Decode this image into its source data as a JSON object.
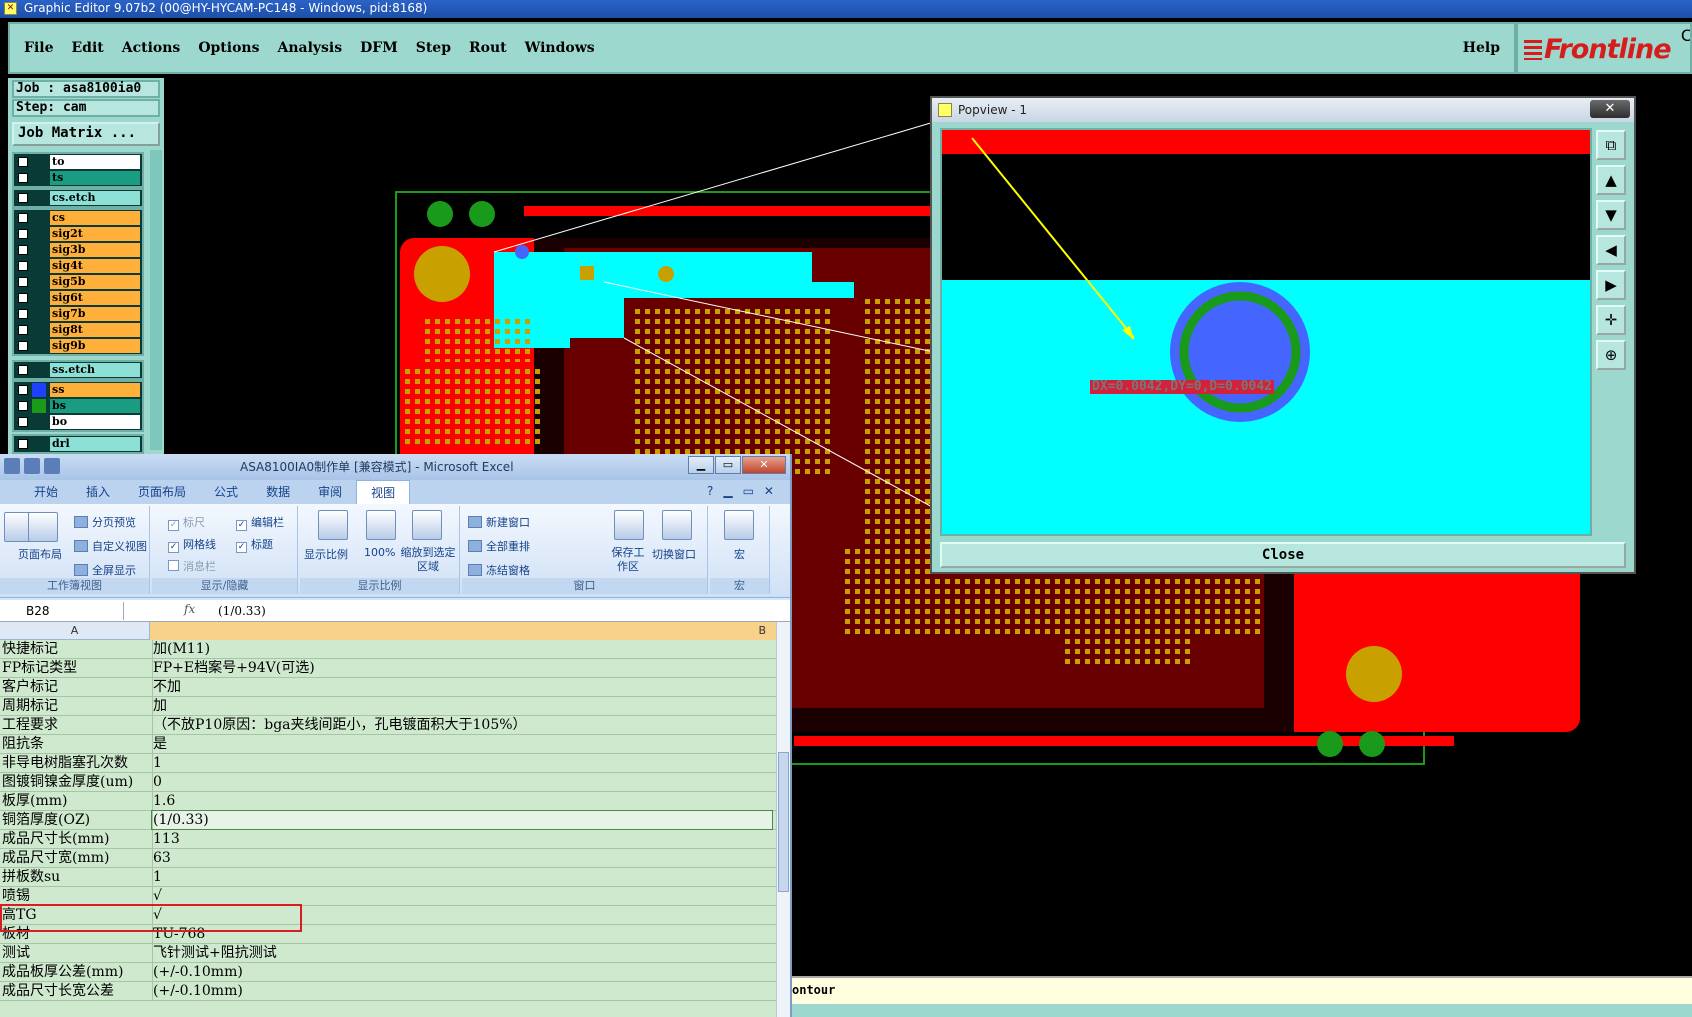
{
  "titlebar": {
    "title": "Graphic Editor 9.07b2 (00@HY-HYCAM-PC148 - Windows, pid:8168)"
  },
  "menu": {
    "items": [
      {
        "label": "File"
      },
      {
        "label": "Edit"
      },
      {
        "label": "Actions"
      },
      {
        "label": "Options"
      },
      {
        "label": "Analysis"
      },
      {
        "label": "DFM"
      },
      {
        "label": "Step"
      },
      {
        "label": "Rout"
      },
      {
        "label": "Windows"
      }
    ],
    "help": "Help"
  },
  "brand": {
    "logo": "Frontline",
    "corner": "C"
  },
  "job": {
    "job_line": "Job : asa8100ia0",
    "step_line": "Step: cam",
    "matrix_button": "Job Matrix ..."
  },
  "layers": {
    "group1": [
      {
        "name": "to",
        "style": "white"
      },
      {
        "name": "ts",
        "style": "green"
      }
    ],
    "group2": [
      {
        "name": "cs.etch",
        "style": "cyan"
      }
    ],
    "group3": [
      {
        "name": "cs"
      },
      {
        "name": "sig2t"
      },
      {
        "name": "sig3b"
      },
      {
        "name": "sig4t"
      },
      {
        "name": "sig5b"
      },
      {
        "name": "sig6t"
      },
      {
        "name": "sig7b"
      },
      {
        "name": "sig8t"
      },
      {
        "name": "sig9b"
      }
    ],
    "group4": [
      {
        "name": "ss.etch",
        "style": "cyan"
      }
    ],
    "group5": [
      {
        "name": "ss",
        "style": "pink"
      },
      {
        "name": "bs",
        "style": "green"
      },
      {
        "name": "bo",
        "style": "white"
      }
    ],
    "group6": [
      {
        "name": "drl",
        "style": "cyan"
      }
    ]
  },
  "colors": {
    "board_red": "#ff0000",
    "copper_gold": "#c8a000",
    "cyan_fill": "#00ffff",
    "panel_teal": "#9dd8cf",
    "pad_blue": "#4466ff",
    "ring_green": "#1a9a1a"
  },
  "popview": {
    "title": "Popview - 1",
    "close_x": "✕",
    "measure": "DX=0.0042,DY=0,D=0.0042",
    "close_button": "Close",
    "tools": [
      "zoom-window-icon",
      "pan-up-icon",
      "pan-down-icon",
      "pan-left-icon",
      "pan-right-icon",
      "zoom-home-icon",
      "zoom-fit-icon"
    ]
  },
  "status": {
    "text": "ontour"
  },
  "excel": {
    "title": "ASA8100IA0制作单 [兼容模式] - Microsoft Excel",
    "tabs": [
      {
        "label": "开始"
      },
      {
        "label": "插入"
      },
      {
        "label": "页面布局"
      },
      {
        "label": "公式"
      },
      {
        "label": "数据"
      },
      {
        "label": "审阅"
      },
      {
        "label": "视图",
        "active": true
      }
    ],
    "ribbon": {
      "views_group": "工作簿视图",
      "page_layout": "页面布局",
      "page_break": "分页预览",
      "custom_view": "自定义视图",
      "full_screen": "全屏显示",
      "show_group": "显示/隐藏",
      "ruler": "标尺",
      "gridlines": "网格线",
      "message_bar": "消息栏",
      "formula_bar": "编辑栏",
      "headings": "标题",
      "zoom_group": "显示比例",
      "zoom": "显示比例",
      "zoom100": "100%",
      "zoom_sel": "缩放到选定区域",
      "window_group": "窗口",
      "new_window": "新建窗口",
      "arrange_all": "全部重排",
      "freeze": "冻结窗格",
      "save_ws": "保存工作区",
      "switch_win": "切换窗口",
      "macro_group": "宏",
      "macro": "宏"
    },
    "name_box": "B28",
    "fx": "fx",
    "formula_value": "(1/0.33)",
    "col_a": "A",
    "col_b": "B",
    "rows": [
      {
        "a": "快捷标记",
        "b": "加(M11)"
      },
      {
        "a": "FP标记类型",
        "b": "FP+E档案号+94V(可选)"
      },
      {
        "a": "客户标记",
        "b": "不加"
      },
      {
        "a": "周期标记",
        "b": "加"
      },
      {
        "a": "工程要求",
        "b": "（不放P10原因：bga夹线间距小，孔电镀面积大于105%）"
      },
      {
        "a": "阻抗条",
        "b": "是"
      },
      {
        "a": "非导电树脂塞孔次数",
        "b": "1"
      },
      {
        "a": "图镀铜镍金厚度(um)",
        "b": "0"
      },
      {
        "a": "板厚(mm)",
        "b": "1.6"
      },
      {
        "a": "铜箔厚度(OZ)",
        "b": "(1/0.33)",
        "selected": true
      },
      {
        "a": "成品尺寸长(mm)",
        "b": "113"
      },
      {
        "a": "成品尺寸宽(mm)",
        "b": "63"
      },
      {
        "a": "拼板数su",
        "b": "1"
      },
      {
        "a": "喷锡",
        "b": "√"
      },
      {
        "a": "高TG",
        "b": "√"
      },
      {
        "a": "板材",
        "b": "TU-768"
      },
      {
        "a": "测试",
        "b": "飞针测试+阻抗测试"
      },
      {
        "a": "成品板厚公差(mm)",
        "b": "(+/-0.10mm)"
      },
      {
        "a": "成品尺寸长宽公差",
        "b": "(+/-0.10mm)"
      }
    ]
  }
}
